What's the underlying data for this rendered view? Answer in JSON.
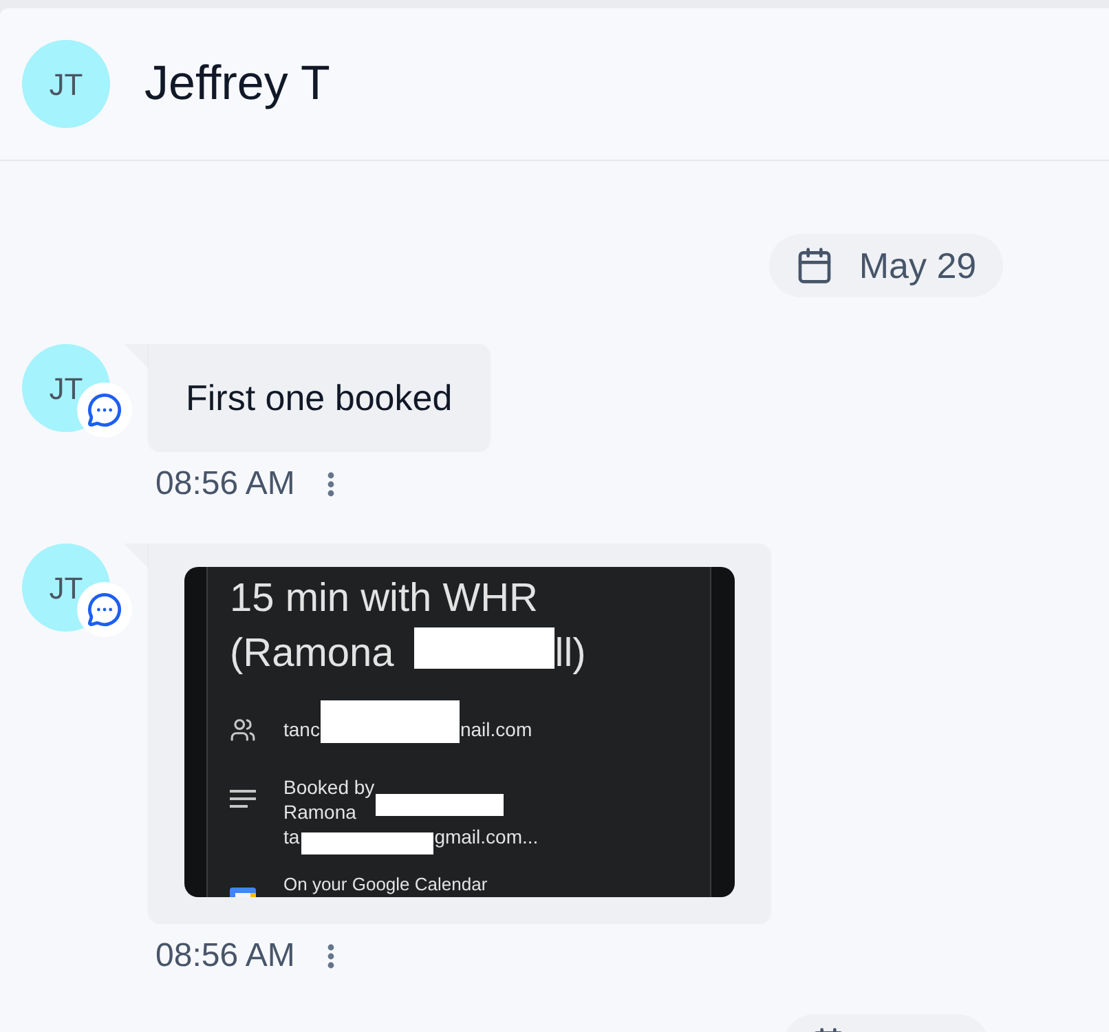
{
  "header": {
    "avatar_initials": "JT",
    "name": "Jeffrey T"
  },
  "timeline": [
    {
      "kind": "date",
      "label": "May 29"
    },
    {
      "kind": "text",
      "avatar_initials": "JT",
      "text": "First one booked",
      "time": "08:56 AM"
    },
    {
      "kind": "image",
      "avatar_initials": "JT",
      "screenshot": {
        "title": "15 min with WHR",
        "title_line_2": [
          "(Ramona",
          "ll)"
        ],
        "guest": [
          "tanc",
          "nail.com"
        ],
        "description": [
          [
            "Booked by"
          ],
          [
            "Ramona"
          ],
          [
            "ta",
            "gmail.com..."
          ]
        ],
        "calendar_note": "On your Google Calendar"
      },
      "time": "08:56 AM"
    },
    {
      "kind": "date"
    }
  ]
}
